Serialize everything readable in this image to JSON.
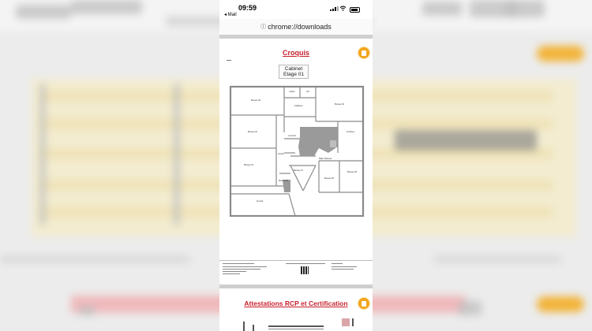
{
  "status_bar": {
    "time": "09:59",
    "back_label": "◂ Mail"
  },
  "browser": {
    "url": "chrome://downloads"
  },
  "document": {
    "croquis_title": "Croquis",
    "cabinet_label_line1": "Cabinet",
    "cabinet_label_line2": "Etage 01",
    "plan_labels": {
      "bureau01": "Bureau 01",
      "bureau02": "Bureau 02",
      "bureau03": "Bureau 03",
      "bureau04": "Bureau 04",
      "bureau05": "Bureau 05",
      "bureau06": "Bureau 06",
      "bureau07": "Bureau 07",
      "bureau08": "Bureau 08",
      "accueil": "Accueil",
      "archives": "Archives",
      "cafeteria": "Cafétéria",
      "local": "Local 01",
      "salle": "Salle d'attente",
      "couloir": "Couloir",
      "wc": "Wc",
      "cellier": "Cellier"
    },
    "attestations_title": "Attestations RCP et Certification"
  },
  "colors": {
    "title_red": "#c71f2c",
    "badge_orange": "#f2a51e",
    "wall": "#8a8a8a",
    "fill": "#9a9a9a"
  }
}
